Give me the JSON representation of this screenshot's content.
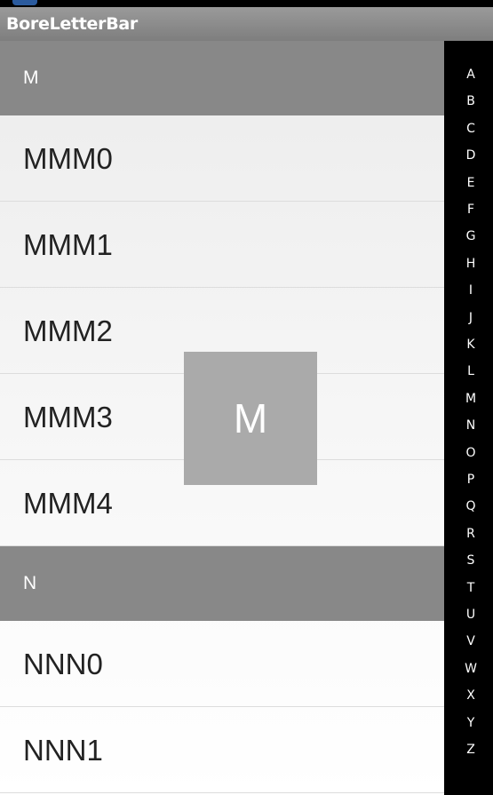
{
  "app": {
    "title": "BoreLetterBar"
  },
  "list": {
    "sections": [
      {
        "header": "M",
        "items": [
          "MMM0",
          "MMM1",
          "MMM2",
          "MMM3",
          "MMM4"
        ]
      },
      {
        "header": "N",
        "items": [
          "NNN0",
          "NNN1"
        ]
      }
    ]
  },
  "letter_bar": {
    "letters": [
      "A",
      "B",
      "C",
      "D",
      "E",
      "F",
      "G",
      "H",
      "I",
      "J",
      "K",
      "L",
      "M",
      "N",
      "O",
      "P",
      "Q",
      "R",
      "S",
      "T",
      "U",
      "V",
      "W",
      "X",
      "Y",
      "Z"
    ]
  },
  "overlay": {
    "letter": "M"
  }
}
